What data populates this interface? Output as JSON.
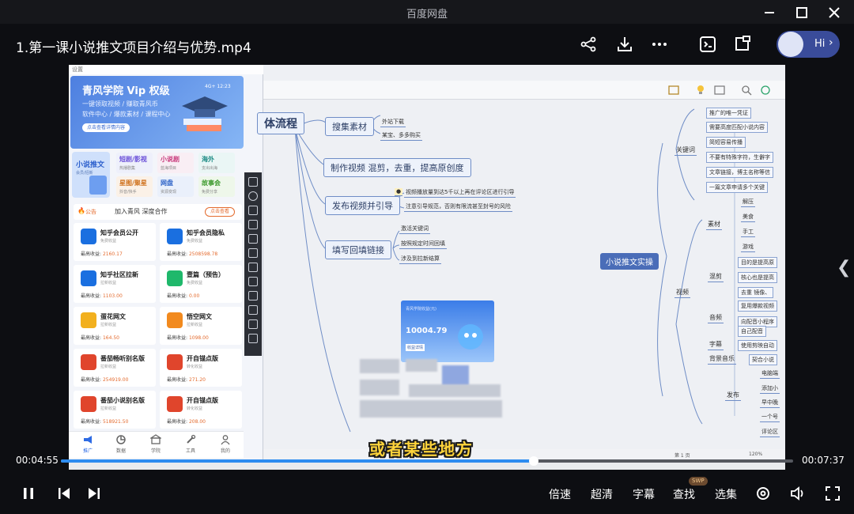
{
  "window": {
    "app_title": "百度网盘"
  },
  "header": {
    "file_title": "1.第一课小说推文项目介绍与优势.mp4",
    "assistant_label": "Hi"
  },
  "phone": {
    "window_caption": "设置",
    "banner": {
      "title": "青风学院 Vip 权级",
      "line1": "一键领取视频 / 赚取青风币",
      "line2": "软件中心 / 爆款素材 / 课程中心",
      "button": "点击查看详情内容",
      "status": "4G+ 12:23"
    },
    "grid": {
      "featured": {
        "title": "小说推文",
        "sub": "会员/招新"
      },
      "cells": [
        {
          "title": "短剧/影视",
          "sub": "热播剧集"
        },
        {
          "title": "小说剧",
          "sub": "蓝海项目"
        },
        {
          "title": "海外",
          "sub": "支出出海"
        },
        {
          "title": "星图/聚星",
          "sub": "抖音/快手"
        },
        {
          "title": "网盘",
          "sub": "资源变现"
        },
        {
          "title": "故事会",
          "sub": "免费分享"
        }
      ]
    },
    "notice": {
      "label": "公告",
      "text": "加入青风 深度合作",
      "button": "点击查看"
    },
    "earn_prefix": "最高收益:",
    "projects": [
      {
        "name": "知乎会员公开",
        "sub": "免费收益",
        "earn": "2160.17",
        "color": "#1a6fe0"
      },
      {
        "name": "知乎会员隐私",
        "sub": "免费收益",
        "earn": "2508598.78",
        "color": "#1a6fe0"
      },
      {
        "name": "知乎社区拉新",
        "sub": "拉新收益",
        "earn": "1103.00",
        "color": "#1a6fe0"
      },
      {
        "name": "壹篇（预告）",
        "sub": "免费收益",
        "earn": "0.00",
        "color": "#1fb86b"
      },
      {
        "name": "蛋花网文",
        "sub": "拉新收益",
        "earn": "164.50",
        "color": "#f2b01e"
      },
      {
        "name": "悟空网文",
        "sub": "拉新收益",
        "earn": "1098.00",
        "color": "#f28a1e"
      },
      {
        "name": "番茄畅听别名版",
        "sub": "拉新收益",
        "earn": "254919.00",
        "color": "#e0452c"
      },
      {
        "name": "开自锚点版",
        "sub": "转化收益",
        "earn": "271.20",
        "color": "#e0452c"
      },
      {
        "name": "番茄小说别名版",
        "sub": "拉新收益",
        "earn": "518921.50",
        "color": "#e0452c"
      },
      {
        "name": "开自锚点版",
        "sub": "转化收益",
        "earn": "208.00",
        "color": "#e0452c"
      }
    ],
    "tabs": [
      "推广",
      "数据",
      "学院",
      "工具",
      "我的"
    ]
  },
  "mindmap": {
    "root": "体流程",
    "branches": [
      {
        "label": "搜集素材",
        "leaves": [
          "外站下载",
          "某宝、多多购买"
        ]
      },
      {
        "label": "制作视频  混剪，去重，提高原创度",
        "leaves": []
      },
      {
        "label": "发布视频并引导",
        "leaves": [
          "视频播放量到达5千以上再在评论区进行引导",
          "注意引导规范，否则有限流甚至封号的风险"
        ]
      },
      {
        "label": "填写回填链接",
        "leaves": [
          "激活关键词",
          "按照规定时间回填",
          "涉及到拉新结算"
        ]
      }
    ],
    "center": "小说推文实操",
    "right_groups": [
      {
        "label": "关键词",
        "items": [
          "推广的唯一凭证",
          "需要高度匹配小说内容",
          "简短容易传播",
          "不要有特殊字符，生僻字",
          "文章链接，博主名称等信",
          "一篇文章申请多个关键"
        ]
      },
      {
        "label": "素材",
        "items": [
          "解压",
          "美食",
          "手工",
          "游戏"
        ]
      },
      {
        "label": "视频",
        "items": []
      },
      {
        "label": "混剪",
        "items": [
          "目的是提高原",
          "核心也是提高",
          "去重  镜像、"
        ]
      },
      {
        "label": "音频",
        "items": [
          "复用爆款视频",
          "向配音小程序",
          "自己配音"
        ]
      },
      {
        "label": "字幕",
        "items": [
          "使用剪映自动"
        ]
      },
      {
        "label": "背景音乐",
        "items": [
          "契合小说"
        ]
      },
      {
        "label": "发布",
        "items": [
          "电脑端",
          "添加小",
          "早中晚",
          "一个号",
          "评论区"
        ]
      }
    ],
    "popup": {
      "label": "青风学院收益(元)",
      "value": "10004.79",
      "withdraw": "收益详情"
    },
    "status_zoom": "120%",
    "status_page": "第 1 页"
  },
  "subtitle": "或者某些地方",
  "player": {
    "current_time": "00:04:55",
    "total_time": "00:07:37",
    "progress_fraction": 0.6455,
    "buffered_fraction": 0.65,
    "buttons": {
      "speed": "倍速",
      "quality": "超清",
      "subtitles": "字幕",
      "search": "查找",
      "episodes": "选集"
    },
    "search_badge": "SWP"
  }
}
